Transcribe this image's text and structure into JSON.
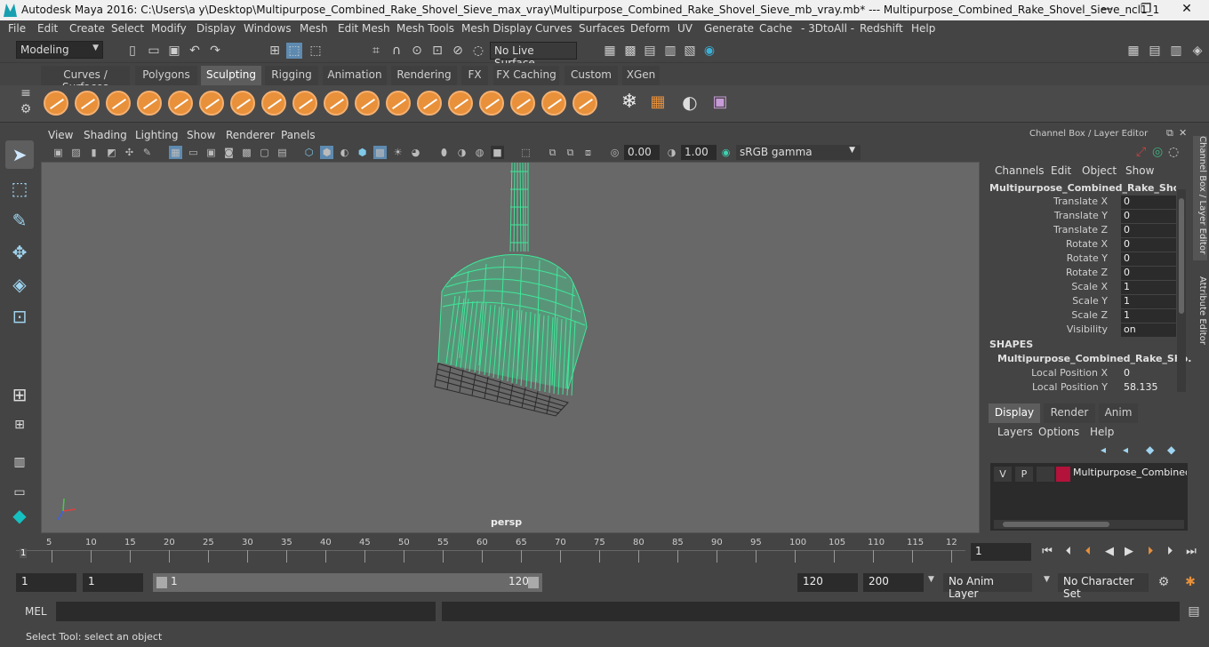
{
  "titlebar": {
    "title": "Autodesk Maya 2016: C:\\Users\\a y\\Desktop\\Multipurpose_Combined_Rake_Shovel_Sieve_max_vray\\Multipurpose_Combined_Rake_Shovel_Sieve_mb_vray.mb*   ---   Multipurpose_Combined_Rake_Shovel_Sieve_ncl1_1",
    "minimize": "—",
    "maximize": "❐",
    "close": "✕"
  },
  "menubar": [
    "File",
    "Edit",
    "Create",
    "Select",
    "Modify",
    "Display",
    "Windows",
    "Mesh",
    "Edit Mesh",
    "Mesh Tools",
    "Mesh Display",
    "Curves",
    "Surfaces",
    "Deform",
    "UV",
    "Generate",
    "Cache",
    "- 3DtoAll -",
    "Redshift",
    "Help"
  ],
  "statusline": {
    "mode": "Modeling",
    "live_surface": "No Live Surface"
  },
  "shelf_tabs": [
    "Curves / Surfaces",
    "Polygons",
    "Sculpting",
    "Rigging",
    "Animation",
    "Rendering",
    "FX",
    "FX Caching",
    "Custom",
    "XGen"
  ],
  "active_shelf_tab": "Sculpting",
  "viewport": {
    "menu": [
      "View",
      "Shading",
      "Lighting",
      "Show",
      "Renderer",
      "Panels"
    ],
    "field_a": "0.00",
    "field_b": "1.00",
    "colorspace": "sRGB gamma",
    "camera": "persp"
  },
  "channel_box": {
    "header": "Channel Box / Layer Editor",
    "menu": [
      "Channels",
      "Edit",
      "Object",
      "Show"
    ],
    "object_name": "Multipurpose_Combined_Rake_Shove...",
    "channels": [
      {
        "label": "Translate X",
        "value": "0"
      },
      {
        "label": "Translate Y",
        "value": "0"
      },
      {
        "label": "Translate Z",
        "value": "0"
      },
      {
        "label": "Rotate X",
        "value": "0"
      },
      {
        "label": "Rotate Y",
        "value": "0"
      },
      {
        "label": "Rotate Z",
        "value": "0"
      },
      {
        "label": "Scale X",
        "value": "1"
      },
      {
        "label": "Scale Y",
        "value": "1"
      },
      {
        "label": "Scale Z",
        "value": "1"
      },
      {
        "label": "Visibility",
        "value": "on"
      }
    ],
    "shapes_header": "SHAPES",
    "shape_name": "Multipurpose_Combined_Rake_Sho...",
    "shape_channels": [
      {
        "label": "Local Position X",
        "value": "0"
      },
      {
        "label": "Local Position Y",
        "value": "58.135"
      }
    ]
  },
  "layer_editor": {
    "tabs": [
      "Display",
      "Render",
      "Anim"
    ],
    "active_tab": "Display",
    "menu": [
      "Layers",
      "Options",
      "Help"
    ],
    "layer": {
      "v": "V",
      "p": "P",
      "name": "Multipurpose_Combined",
      "color": "#b3123a"
    }
  },
  "side_tabs": [
    "Channel Box / Layer Editor",
    "Attribute Editor"
  ],
  "timeline": {
    "ticks": [
      "5",
      "10",
      "15",
      "20",
      "25",
      "30",
      "35",
      "40",
      "45",
      "50",
      "55",
      "60",
      "65",
      "70",
      "75",
      "80",
      "85",
      "90",
      "95",
      "100",
      "105",
      "110",
      "115",
      "12"
    ],
    "start_label": "1",
    "current_frame": "1"
  },
  "range": {
    "start": "1",
    "playback_start": "1",
    "slider_start": "1",
    "slider_end": "120",
    "playback_end": "120",
    "end": "200",
    "anim_layer": "No Anim Layer",
    "character_set": "No Character Set"
  },
  "cmdline": {
    "label": "MEL"
  },
  "helpline": {
    "text": "Select Tool: select an object"
  },
  "colors": {
    "wire": "#3fe89a",
    "layer": "#b3123a",
    "accent": "#e8903a"
  }
}
